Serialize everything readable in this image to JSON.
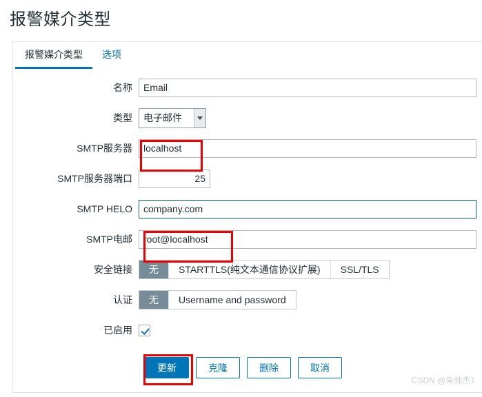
{
  "page": {
    "title": "报警媒介类型"
  },
  "tabs": [
    {
      "label": "报警媒介类型",
      "active": true
    },
    {
      "label": "选项",
      "active": false
    }
  ],
  "form": {
    "name": {
      "label": "名称",
      "value": "Email"
    },
    "type": {
      "label": "类型",
      "value": "电子邮件",
      "options": [
        "电子邮件"
      ]
    },
    "smtp_server": {
      "label": "SMTP服务器",
      "value": "localhost"
    },
    "smtp_port": {
      "label": "SMTP服务器端口",
      "value": "25"
    },
    "smtp_helo": {
      "label": "SMTP HELO",
      "value": "company.com",
      "focused": true
    },
    "smtp_email": {
      "label": "SMTP电邮",
      "value": "root@localhost"
    },
    "security": {
      "label": "安全链接",
      "options": [
        {
          "label": "无",
          "selected": true
        },
        {
          "label": "STARTTLS(纯文本通信协议扩展)",
          "selected": false
        },
        {
          "label": "SSL/TLS",
          "selected": false
        }
      ]
    },
    "authentication": {
      "label": "认证",
      "options": [
        {
          "label": "无",
          "selected": true
        },
        {
          "label": "Username and password",
          "selected": false
        }
      ]
    },
    "enabled": {
      "label": "已启用",
      "checked": true
    }
  },
  "buttons": {
    "update": "更新",
    "clone": "克隆",
    "delete": "删除",
    "cancel": "取消"
  },
  "watermark": "CSDN @朱帅杰1",
  "colors": {
    "accent": "#0275b8",
    "segment_selected": "#768d99",
    "annotation": "#ee0000",
    "text": "#1f2c33"
  }
}
